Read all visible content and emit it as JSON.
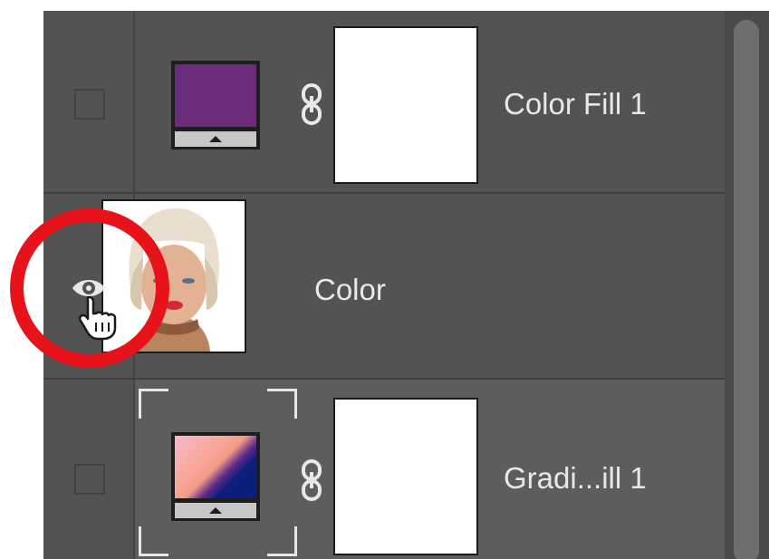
{
  "layers": [
    {
      "name": "Color Fill 1",
      "visible": false,
      "thumb_color": "#6b2d79",
      "thumb_type": "fill"
    },
    {
      "name": "Color",
      "visible": true,
      "thumb_type": "photo"
    },
    {
      "name": "Gradi...ill 1",
      "visible": false,
      "thumb_type": "gradient",
      "selected": true,
      "gradient_colors": [
        "#f7b8c9",
        "#f59a86",
        "#0a1f7a"
      ]
    }
  ],
  "colors": {
    "panel_bg": "#535353",
    "selected_row_bg": "#5d5d5d",
    "highlight_ring": "#e8121b"
  },
  "icons": [
    "eye-icon",
    "hand-pointer-icon",
    "chain-link-icon",
    "fill-layer-icon",
    "gradient-layer-icon"
  ]
}
